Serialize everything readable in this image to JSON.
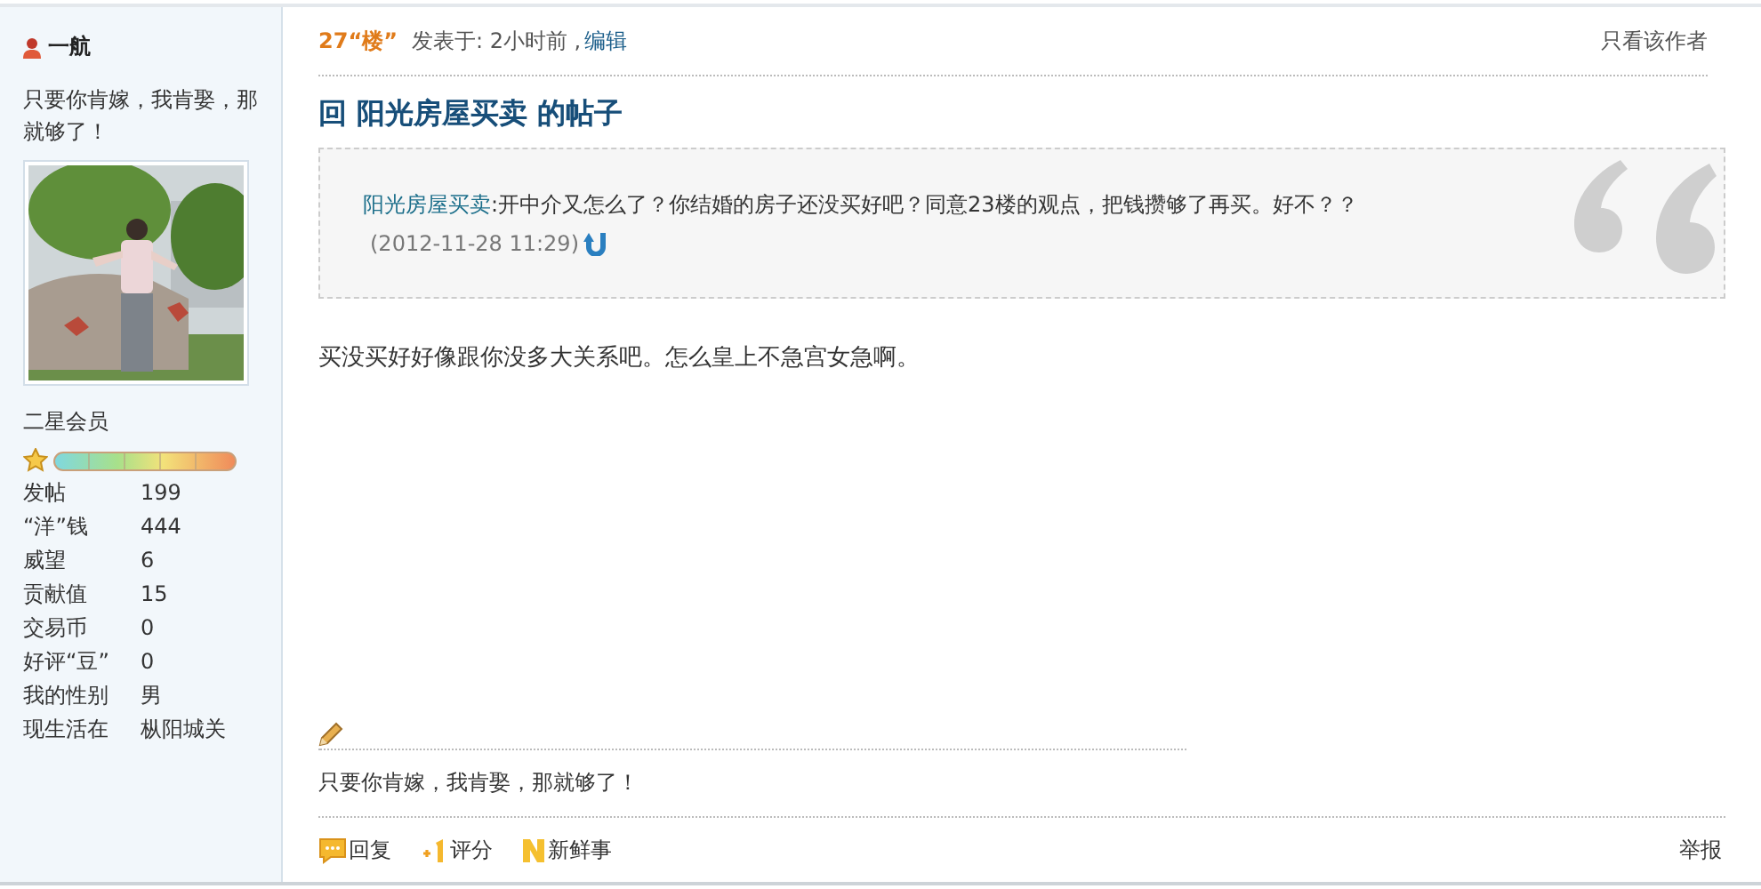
{
  "author": {
    "name": "一航",
    "signature": "只要你肯嫁，我肯娶，那就够了！",
    "rank": "二星会员",
    "stats": [
      {
        "label": "发帖",
        "value": "199"
      },
      {
        "label": "“洋”钱",
        "value": "444"
      },
      {
        "label": "威望",
        "value": "6"
      },
      {
        "label": "贡献值",
        "value": "15"
      },
      {
        "label": "交易币",
        "value": "0"
      },
      {
        "label": "好评“豆”",
        "value": "0"
      },
      {
        "label": "我的性别",
        "value": "男"
      },
      {
        "label": "现生活在",
        "value": "枞阳城关"
      }
    ]
  },
  "post": {
    "floor": "27“楼”",
    "posted": "发表于: 2小时前 ,",
    "edit": "编辑",
    "only_author": "只看该作者",
    "title": "回 阳光房屋买卖 的帖子",
    "quote": {
      "author": "阳光房屋买卖",
      "text": ":开中介又怎么了？你结婚的房子还没买好吧？同意23楼的观点，把钱攒够了再买。好不？？",
      "time": "(2012-11-28 11:29)"
    },
    "body": "买没买好好像跟你没多大关系吧。怎么皇上不急宫女急啊。",
    "signature": "只要你肯嫁，我肯娶，那就够了！",
    "actions": [
      {
        "kind": "reply",
        "label": "回复"
      },
      {
        "kind": "rate",
        "label": "评分"
      },
      {
        "kind": "news",
        "label": "新鲜事"
      }
    ],
    "report": "举报"
  }
}
